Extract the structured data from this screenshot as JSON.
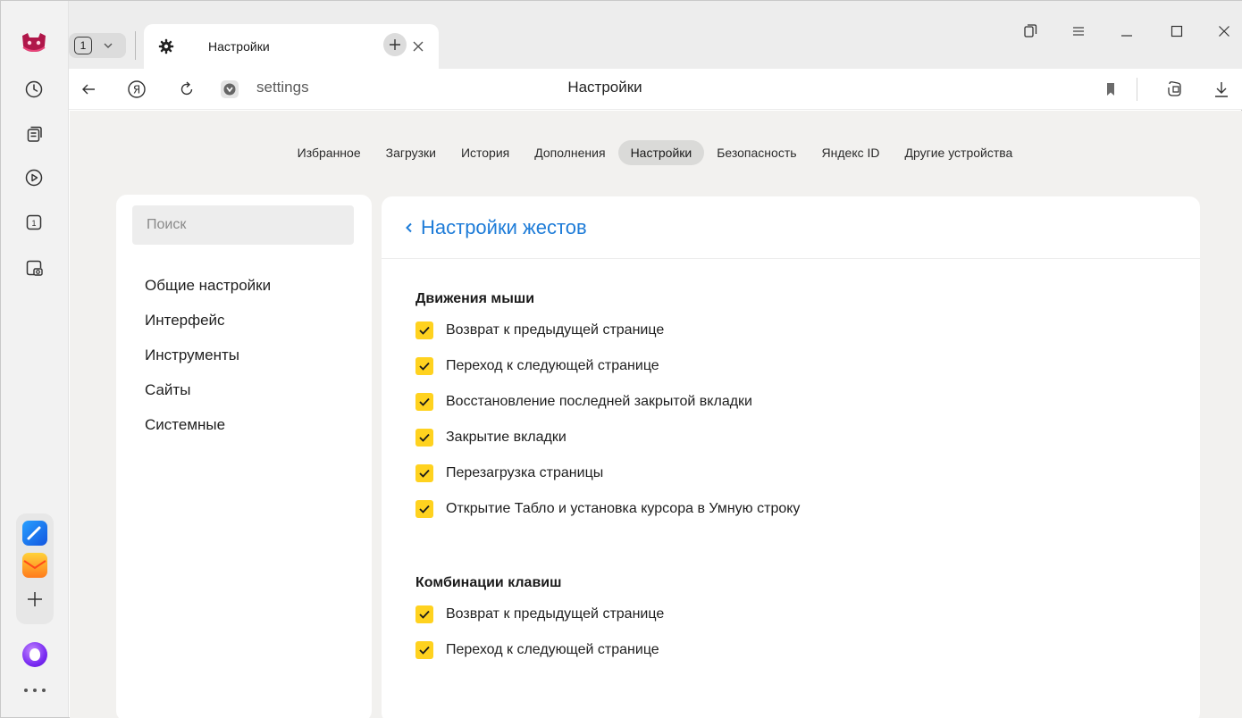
{
  "tab_strip": {
    "tab_count": "1",
    "active_tab_title": "Настройки"
  },
  "address_bar": {
    "url": "settings",
    "page_title": "Настройки"
  },
  "top_nav": {
    "items": [
      "Избранное",
      "Загрузки",
      "История",
      "Дополнения",
      "Настройки",
      "Безопасность",
      "Яндекс ID",
      "Другие устройства"
    ],
    "active": "Настройки"
  },
  "sidebar": {
    "search_placeholder": "Поиск",
    "items": [
      "Общие настройки",
      "Интерфейс",
      "Инструменты",
      "Сайты",
      "Системные"
    ]
  },
  "main": {
    "title": "Настройки жестов",
    "sections": [
      {
        "title": "Движения мыши",
        "options": [
          {
            "label": "Возврат к предыдущей странице",
            "checked": true
          },
          {
            "label": "Переход к следующей странице",
            "checked": true
          },
          {
            "label": "Восстановление последней закрытой вкладки",
            "checked": true
          },
          {
            "label": "Закрытие вкладки",
            "checked": true
          },
          {
            "label": "Перезагрузка страницы",
            "checked": true
          },
          {
            "label": "Открытие Табло и установка курсора в Умную строку",
            "checked": true
          }
        ]
      },
      {
        "title": "Комбинации клавиш",
        "options": [
          {
            "label": "Возврат к предыдущей странице",
            "checked": true
          },
          {
            "label": "Переход к следующей странице",
            "checked": true
          }
        ]
      }
    ]
  },
  "colors": {
    "accent_link": "#1e7cd8",
    "checkbox": "#ffd21f",
    "page_bg": "#f2f1ef"
  },
  "icons": {
    "sidebar": [
      "history-icon",
      "collections-icon",
      "video-icon",
      "tabs-counter-icon",
      "screenshot-icon",
      "messenger-app-icon",
      "mail-app-icon",
      "add-app-icon",
      "alice-icon",
      "more-icon"
    ],
    "toolbar": [
      "back-icon",
      "yandex-icon",
      "reload-icon",
      "site-info-icon",
      "bookmark-icon",
      "protect-icon",
      "downloads-icon"
    ]
  }
}
